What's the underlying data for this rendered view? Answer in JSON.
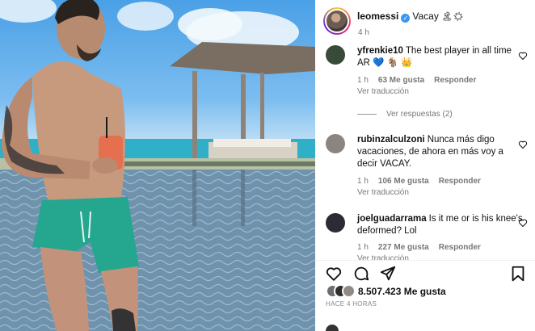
{
  "post": {
    "owner_username": "leomessi",
    "verified_mark": "✓",
    "caption": "Vacay",
    "caption_emojis": "🏝☀",
    "time_ago": "4 h",
    "likes_count_text": "8.507.423 Me gusta",
    "posted_ago_caps": "HACE 4 HORAS"
  },
  "comments": [
    {
      "username": "yfrenkie10",
      "text": "The best player in all time",
      "text_line2": "AR 💙 🐐 👑",
      "time": "1 h",
      "likes": "63 Me gusta",
      "reply_label": "Responder",
      "translate_label": "Ver traducción",
      "view_replies": "Ver respuestas (2)",
      "avatar_color": "#3a4a3a"
    },
    {
      "username": "rubinzalculzoni",
      "text": "Nunca más digo vacaciones, de ahora en más voy a decir VACAY.",
      "time": "1 h",
      "likes": "106 Me gusta",
      "reply_label": "Responder",
      "translate_label": "Ver traducción",
      "avatar_color": "#8a8580"
    },
    {
      "username": "joelguadarrama",
      "text": "Is it me or is his knee's deformed? Lol",
      "time": "1 h",
      "likes": "227 Me gusta",
      "reply_label": "Responder",
      "translate_label": "Ver traducción",
      "avatar_color": "#2b2b33"
    }
  ],
  "icons": {
    "like": "heart-icon",
    "comment": "comment-icon",
    "share": "share-icon",
    "save": "bookmark-icon",
    "comment_like": "heart-icon",
    "verified": "verified-badge-icon"
  },
  "colors": {
    "verified_blue": "#3897f0",
    "meta_gray": "#777777"
  }
}
